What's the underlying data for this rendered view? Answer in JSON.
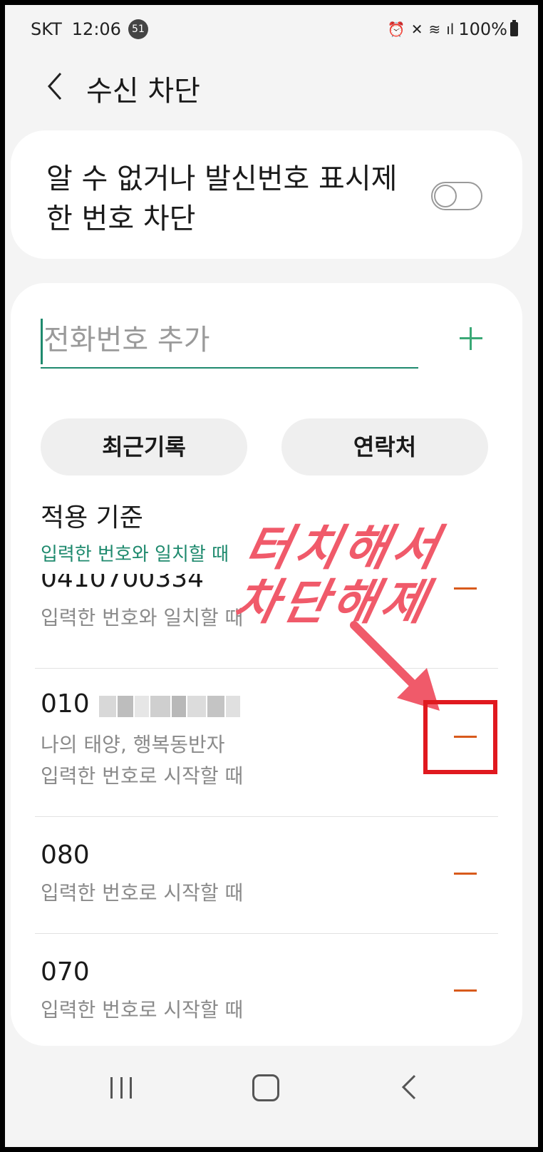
{
  "status_bar": {
    "carrier": "SKT",
    "time": "12:06",
    "notification_count": "51",
    "battery": "100%"
  },
  "header": {
    "title": "수신 차단"
  },
  "unknown_block": {
    "label": "알 수 없거나 발신번호 표시제한 번호 차단",
    "enabled": false
  },
  "add_number": {
    "placeholder": "전화번호 추가"
  },
  "buttons": {
    "recent": "최근기록",
    "contacts": "연락처"
  },
  "criteria": {
    "title": "적용 기준",
    "value": "입력한 번호와 일치할 때"
  },
  "blocked_numbers": [
    {
      "number": "0410700334",
      "sub": "입력한 번호와 일치할 때"
    },
    {
      "number": "010",
      "name": "나의 태양, 행복동반자",
      "sub": "입력한 번호로 시작할 때"
    },
    {
      "number": "080",
      "sub": "입력한 번호로 시작할 때"
    },
    {
      "number": "070",
      "sub": "입력한 번호로 시작할 때"
    }
  ],
  "annotation": {
    "line1": "터치해서",
    "line2": "차단해제",
    "color": "#f05a6a",
    "box_color": "#e0191f"
  },
  "colors": {
    "accent": "#1f8a6e",
    "remove": "#d85a1c",
    "background": "#f4f4f4"
  },
  "icons": {
    "back": "chevron-left-icon",
    "add": "plus-icon",
    "remove": "minus-icon"
  }
}
